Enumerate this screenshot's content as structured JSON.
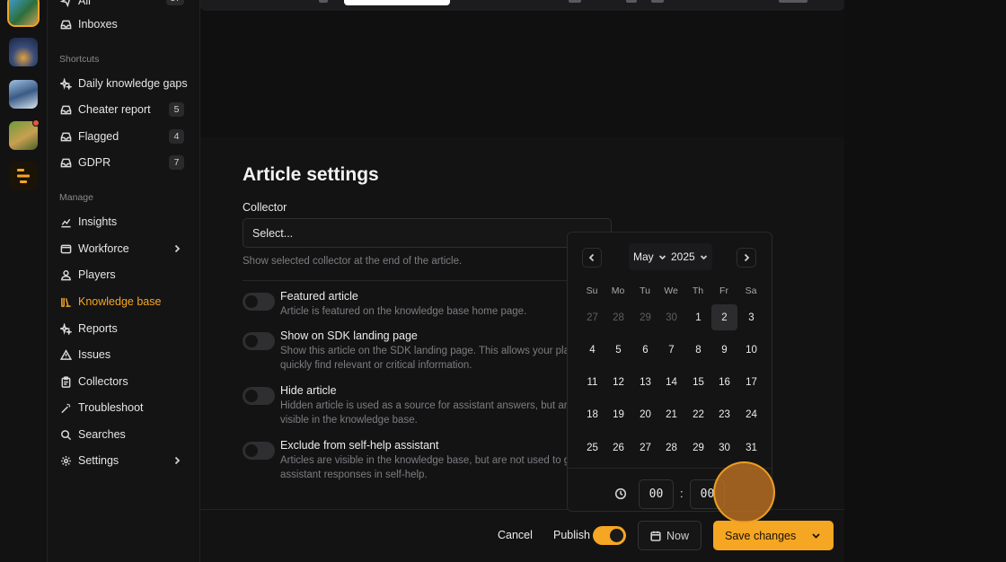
{
  "colors": {
    "accent": "#f5a623",
    "bg": "#0f0f10",
    "panel": "#141415"
  },
  "sidebar": {
    "top_items": [
      {
        "label": "Inboxes",
        "icon": "inbox-icon"
      }
    ],
    "shortcuts_heading": "Shortcuts",
    "shortcuts": [
      {
        "label": "Daily knowledge gaps",
        "icon": "sparkle-icon"
      },
      {
        "label": "Cheater report",
        "icon": "inbox-icon",
        "badge": "5"
      },
      {
        "label": "Flagged",
        "icon": "inbox-icon",
        "badge": "4"
      },
      {
        "label": "GDPR",
        "icon": "inbox-icon",
        "badge": "7"
      }
    ],
    "manage_heading": "Manage",
    "manage": [
      {
        "label": "Insights",
        "icon": "chart-icon"
      },
      {
        "label": "Workforce",
        "icon": "window-icon"
      },
      {
        "label": "Players",
        "icon": "user-icon"
      },
      {
        "label": "Knowledge base",
        "icon": "library-icon",
        "active": true
      },
      {
        "label": "Reports",
        "icon": "sparkle-icon"
      },
      {
        "label": "Issues",
        "icon": "warning-icon"
      },
      {
        "label": "Collectors",
        "icon": "clipboard-icon"
      },
      {
        "label": "Troubleshoot",
        "icon": "wand-icon"
      },
      {
        "label": "Searches",
        "icon": "search-icon"
      },
      {
        "label": "Settings",
        "icon": "gear-icon"
      }
    ]
  },
  "article": {
    "title": "Article settings",
    "collector_label": "Collector",
    "collector_placeholder": "Select...",
    "collector_hint": "Show selected collector at the end of the article.",
    "toggles": [
      {
        "title": "Featured article",
        "desc": "Article is featured on the knowledge base home page.",
        "on": false
      },
      {
        "title": "Show on SDK landing page",
        "desc": "Show this article on the SDK landing page. This allows your pla quickly find relevant or critical information.",
        "on": false
      },
      {
        "title": "Hide article",
        "desc": "Hidden article is used as a source for assistant answers, but ar visible in the knowledge base.",
        "on": false
      },
      {
        "title": "Exclude from self-help assistant",
        "desc": "Articles are visible in the knowledge base, but are not used to g assistant responses in self-help.",
        "on": false
      }
    ]
  },
  "footer": {
    "cancel": "Cancel",
    "publish": "Publish",
    "publish_on": true,
    "now": "Now",
    "save": "Save changes"
  },
  "picker": {
    "month": "May",
    "year": "2025",
    "weekdays": [
      "Su",
      "Mo",
      "Tu",
      "We",
      "Th",
      "Fr",
      "Sa"
    ],
    "weeks": [
      [
        "27",
        "28",
        "29",
        "30",
        "1",
        "2",
        "3"
      ],
      [
        "4",
        "5",
        "6",
        "7",
        "8",
        "9",
        "10"
      ],
      [
        "11",
        "12",
        "13",
        "14",
        "15",
        "16",
        "17"
      ],
      [
        "18",
        "19",
        "20",
        "21",
        "22",
        "23",
        "24"
      ],
      [
        "25",
        "26",
        "27",
        "28",
        "29",
        "30",
        "31"
      ]
    ],
    "muted_first_row": 4,
    "selected": "2",
    "hour": "00",
    "minute": "00",
    "colon": ":"
  }
}
